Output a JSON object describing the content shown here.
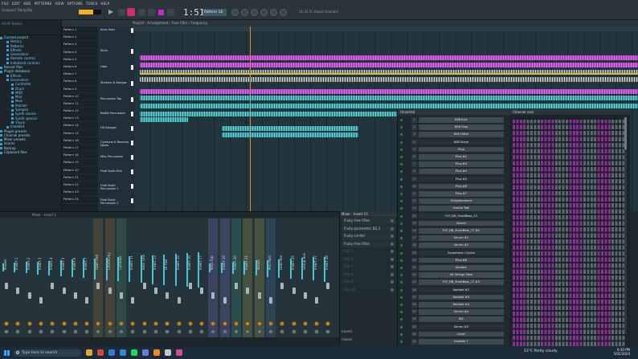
{
  "menu": [
    "FILE",
    "EDIT",
    "ADD",
    "PATTERNS",
    "VIEW",
    "OPTIONS",
    "TOOLS",
    "HELP"
  ],
  "toolbar": {
    "hint": "Snapped 'Bb/ep/Bp",
    "time": "1:51:54",
    "pattern": "Pattern 16",
    "info": "11:43   FL Cloud (Sounds)"
  },
  "browser": {
    "header": "All    All folders",
    "items": [
      {
        "label": "Current project",
        "level": 0
      },
      {
        "label": "History",
        "level": 1
      },
      {
        "label": "Patterns",
        "level": 1
      },
      {
        "label": "Effects",
        "level": 1
      },
      {
        "label": "Generators",
        "level": 1
      },
      {
        "label": "Remote control",
        "level": 1
      },
      {
        "label": "Initialized controls",
        "level": 1
      },
      {
        "label": "Recent files",
        "level": 0
      },
      {
        "label": "Plugin database",
        "level": 0
      },
      {
        "label": "Effects",
        "level": 1
      },
      {
        "label": "Generators",
        "level": 1
      },
      {
        "label": "Controller",
        "level": 2
      },
      {
        "label": "Drum",
        "level": 2
      },
      {
        "label": "MIDI",
        "level": 2
      },
      {
        "label": "Misc",
        "level": 2
      },
      {
        "label": "New",
        "level": 2
      },
      {
        "label": "Patcher",
        "level": 2
      },
      {
        "label": "Sampler",
        "level": 2
      },
      {
        "label": "Synth classic",
        "level": 2
      },
      {
        "label": "Synth special",
        "level": 2
      },
      {
        "label": "Visual",
        "level": 2
      },
      {
        "label": "Installed",
        "level": 1
      },
      {
        "label": "Plugin presets",
        "level": 0
      },
      {
        "label": "Channel presets",
        "level": 0
      },
      {
        "label": "Mixer presets",
        "level": 0
      },
      {
        "label": "Scores",
        "level": 0
      },
      {
        "label": "Backup",
        "level": 0
      },
      {
        "label": "Clipboard files",
        "level": 0
      }
    ]
  },
  "playlist": {
    "title": "Playlist - Arrangement › Free Filter › Frequency",
    "patterns": [
      "Pattern 1",
      "Pattern 2",
      "Pattern 3",
      "Pattern 4",
      "Pattern 5",
      "Pattern 6",
      "Pattern 7",
      "Pattern 8",
      "Pattern 9",
      "Pattern 10",
      "Pattern 11",
      "Pattern 12",
      "Pattern 13",
      "Pattern 14",
      "Pattern 15",
      "Pattern 16",
      "Pattern 17",
      "Pattern 18",
      "Pattern 19",
      "Pattern 20",
      "Pattern 21",
      "Pattern 22",
      "Pattern 23",
      "Pattern 24"
    ],
    "tracks": [
      "Intro Hats",
      "Kicks",
      "Hats",
      "Shakers & Bongos",
      "Percussion Top",
      "Rattle Percussion",
      "Hit Bongos",
      "Cymbals & Reverse Noise",
      "Misc Percussion",
      "Final Build Kick",
      "Final Build Percussion 1",
      "Final Build Percussion 2"
    ]
  },
  "mixer": {
    "title": "Mixer - Insert 1",
    "strips": [
      "Master",
      "Insert 1",
      "Insert 2",
      "Insert 3",
      "Insert 4",
      "Insert 5",
      "Insert 6",
      "Insert 7",
      "Open Pad",
      "Chords Hiy",
      "Cymbals",
      "Insert 11",
      "Bass Line",
      "Insert 13",
      "Dr Pad",
      "Insert 15",
      "Insert 16",
      "Insert 17",
      "Keys Top",
      "Insert 19",
      "Insert 20",
      "Insert 21",
      "Vocals",
      "Mid Pads",
      "Lead Vox",
      "Insert 25",
      "Group Bus",
      "Insert 27",
      "Insert 28"
    ]
  },
  "insert": {
    "title": "Mixer - Insert 15",
    "slots": [
      {
        "label": "Fruity Free Filter",
        "empty": false
      },
      {
        "label": "Fruity parametric EQ 2",
        "empty": false
      },
      {
        "label": "Fruity Limiter",
        "empty": false
      },
      {
        "label": "Fruity Free Filter",
        "empty": false
      },
      {
        "label": "Slot 5",
        "empty": true
      },
      {
        "label": "Slot 6",
        "empty": true
      },
      {
        "label": "Slot 7",
        "empty": true
      },
      {
        "label": "Slot 8",
        "empty": true
      },
      {
        "label": "Slot 9",
        "empty": true
      },
      {
        "label": "Slot 10",
        "empty": true
      }
    ],
    "foot_top": "(none)",
    "foot_bottom": "(none)"
  },
  "rack": {
    "title": "Unsorted",
    "steps_title": "Channel rack",
    "channels": [
      {
        "num": "1",
        "name": "808 Kick"
      },
      {
        "num": "2",
        "name": "808 Clap"
      },
      {
        "num": "3",
        "name": "808 HiHat"
      },
      {
        "num": "4",
        "name": "808 Snare"
      },
      {
        "num": "5",
        "name": "Pluq"
      },
      {
        "num": "6",
        "name": "Pluq #2"
      },
      {
        "num": "7",
        "name": "Pluq #3"
      },
      {
        "num": "8",
        "name": "Pluq #4"
      },
      {
        "num": "9",
        "name": "Pluq #5"
      },
      {
        "num": "10",
        "name": "Pluq #6"
      },
      {
        "num": "11",
        "name": "Pluq #7"
      },
      {
        "num": "12",
        "name": "Enlightenment"
      },
      {
        "num": "13",
        "name": "Fractal Talk"
      },
      {
        "num": "14",
        "name": "FLP_DB_ShortBass_13"
      },
      {
        "num": "15",
        "name": "Serum"
      },
      {
        "num": "16",
        "name": "FLP_DB_ShortBass_17 #2"
      },
      {
        "num": "17",
        "name": "Serum #2"
      },
      {
        "num": "18",
        "name": "Serum #3"
      },
      {
        "num": "19",
        "name": "Symphonic Crystal"
      },
      {
        "num": "20",
        "name": "Pluq #8"
      },
      {
        "num": "21",
        "name": "Kontakt"
      },
      {
        "num": "22",
        "name": "Alt Strings Stow"
      },
      {
        "num": "23",
        "name": "FLP_DB_ShortBass_17 #3"
      },
      {
        "num": "24",
        "name": "Kontakt #2"
      },
      {
        "num": "25",
        "name": "Kontakt #3"
      },
      {
        "num": "26",
        "name": "Kontakt #4"
      },
      {
        "num": "27",
        "name": "Serum #4"
      },
      {
        "num": "28",
        "name": "IN1"
      },
      {
        "num": "29",
        "name": "Serum #5"
      },
      {
        "num": "30",
        "name": "Layer"
      },
      {
        "num": "31",
        "name": "Kontakt 7"
      }
    ]
  },
  "taskbar": {
    "search": "Type here to search",
    "weather": "23°C  Partly cloudy",
    "time": "9:30 PM",
    "date": "5/02/2024"
  }
}
